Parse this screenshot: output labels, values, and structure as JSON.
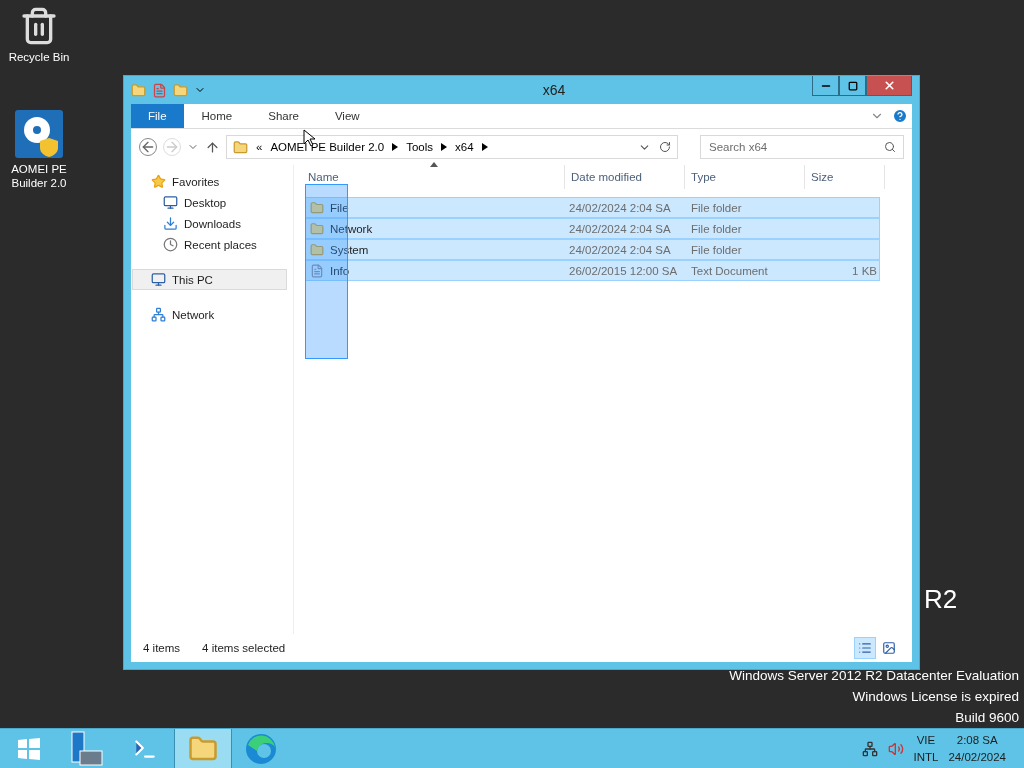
{
  "desktop_icons": [
    {
      "label": "Recycle Bin",
      "kind": "recycle"
    },
    {
      "label": "AOMEI PE Builder 2.0",
      "kind": "aomei"
    }
  ],
  "desktop_text": {
    "edition_tail": "R2",
    "lines": [
      "Windows Server 2012 R2 Datacenter Evaluation",
      "Windows License is expired",
      "Build 9600"
    ]
  },
  "window": {
    "title": "x64",
    "ribbon_tabs": [
      {
        "label": "File",
        "kind": "file"
      },
      {
        "label": "Home",
        "kind": "tab"
      },
      {
        "label": "Share",
        "kind": "tab"
      },
      {
        "label": "View",
        "kind": "tab"
      }
    ],
    "address": {
      "overflow": "«",
      "crumbs": [
        "AOMEI PE Builder 2.0",
        "Tools",
        "x64"
      ]
    },
    "search": {
      "placeholder": "Search x64"
    },
    "nav": [
      {
        "label": "Favorites",
        "kind": "star",
        "selected": false,
        "children": [
          {
            "label": "Desktop",
            "kind": "desktop",
            "selected": false
          },
          {
            "label": "Downloads",
            "kind": "downloads",
            "selected": false
          },
          {
            "label": "Recent places",
            "kind": "recent",
            "selected": false
          }
        ]
      },
      {
        "label": "This PC",
        "kind": "pc",
        "selected": true
      },
      {
        "label": "Network",
        "kind": "network",
        "selected": false
      }
    ],
    "columns": [
      "Name",
      "Date modified",
      "Type",
      "Size"
    ],
    "rows": [
      {
        "name": "File",
        "kind": "folder",
        "date": "24/02/2024 2:04 SA",
        "type": "File folder",
        "selected": true
      },
      {
        "name": "Network",
        "kind": "folder",
        "date": "24/02/2024 2:04 SA",
        "type": "File folder",
        "selected": true
      },
      {
        "name": "System",
        "kind": "folder",
        "date": "24/02/2024 2:04 SA",
        "type": "File folder",
        "selected": true
      },
      {
        "name": "Info",
        "kind": "text",
        "date": "26/02/2015 12:00 SA",
        "type": "Text Document",
        "size": "1 KB",
        "selected": true
      }
    ],
    "status": {
      "count": "4 items",
      "selection": "4 items selected"
    },
    "views": [
      {
        "kind": "details",
        "selected": true
      },
      {
        "kind": "thumbnails",
        "selected": false
      }
    ]
  },
  "taskbar": {
    "apps": [
      {
        "kind": "start",
        "selected": false
      },
      {
        "kind": "server",
        "selected": false
      },
      {
        "kind": "powershell",
        "selected": false
      },
      {
        "kind": "explorer",
        "selected": true
      },
      {
        "kind": "edge",
        "selected": false
      }
    ],
    "language": [
      "VIE",
      "INTL"
    ],
    "time": "2:08 SA",
    "date": "24/02/2024"
  }
}
